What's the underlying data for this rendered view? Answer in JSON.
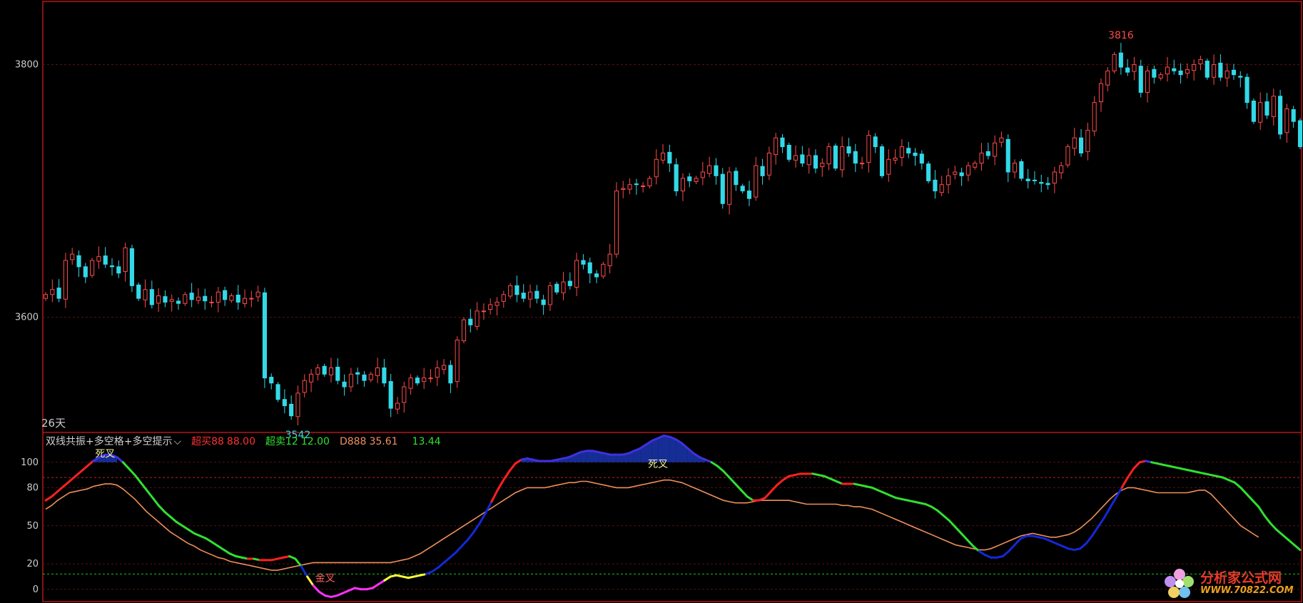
{
  "chart_data": [
    {
      "type": "candlestick",
      "title": "",
      "ylim": [
        3510,
        3850
      ],
      "yticks": [
        3600,
        3800
      ],
      "period_label": "26天",
      "high_label": "3816",
      "low_label": "3542",
      "colors": {
        "up": "#ff4a4a",
        "down": "#33d9e8",
        "frame": "#b01818",
        "grid": "#5a1010"
      },
      "close": [
        3618,
        3622,
        3615,
        3645,
        3650,
        3640,
        3632,
        3645,
        3648,
        3642,
        3640,
        3635,
        3655,
        3625,
        3615,
        3622,
        3610,
        3617,
        3612,
        3614,
        3611,
        3618,
        3614,
        3616,
        3613,
        3612,
        3620,
        3614,
        3617,
        3612,
        3615,
        3615,
        3620,
        3552,
        3548,
        3535,
        3530,
        3522,
        3540,
        3550,
        3555,
        3560,
        3555,
        3560,
        3550,
        3545,
        3555,
        3555,
        3550,
        3555,
        3560,
        3548,
        3528,
        3532,
        3545,
        3552,
        3548,
        3552,
        3552,
        3560,
        3562,
        3548,
        3582,
        3598,
        3594,
        3605,
        3605,
        3610,
        3612,
        3618,
        3625,
        3618,
        3615,
        3620,
        3615,
        3610,
        3625,
        3620,
        3628,
        3625,
        3645,
        3642,
        3635,
        3632,
        3642,
        3650,
        3700,
        3702,
        3705,
        3705,
        3704,
        3710,
        3725,
        3730,
        3722,
        3700,
        3710,
        3708,
        3710,
        3715,
        3720,
        3712,
        3690,
        3715,
        3705,
        3700,
        3694,
        3720,
        3712,
        3730,
        3742,
        3735,
        3725,
        3728,
        3722,
        3728,
        3718,
        3722,
        3735,
        3718,
        3735,
        3730,
        3722,
        3722,
        3744,
        3735,
        3712,
        3725,
        3726,
        3735,
        3730,
        3728,
        3722,
        3708,
        3700,
        3705,
        3712,
        3715,
        3712,
        3720,
        3722,
        3730,
        3728,
        3738,
        3742,
        3715,
        3722,
        3710,
        3708,
        3708,
        3706,
        3705,
        3715,
        3720,
        3735,
        3742,
        3730,
        3748,
        3770,
        3785,
        3795,
        3808,
        3798,
        3794,
        3800,
        3778,
        3795,
        3790,
        3792,
        3798,
        3795,
        3792,
        3796,
        3800,
        3804,
        3790,
        3800,
        3790,
        3795,
        3792,
        3790,
        3770,
        3755,
        3770,
        3760,
        3775,
        3745,
        3765,
        3755,
        3735
      ]
    },
    {
      "type": "line",
      "title": "双线共振+多空格+多空提示",
      "ylim": [
        -8,
        110
      ],
      "yticks": [
        0,
        20,
        50,
        80,
        100
      ],
      "hlines": [
        88,
        12,
        35.61
      ],
      "legend": [
        {
          "label": "超买88",
          "value": "88.00",
          "color": "#ff3030"
        },
        {
          "label": "超卖12",
          "value": "12.00",
          "color": "#30e030"
        },
        {
          "label": "D888",
          "value": "35.61",
          "color": "#f09060"
        },
        {
          "label": "",
          "value": "13.44",
          "color": "#30e030"
        }
      ],
      "annotations": [
        "死叉",
        "死叉",
        "金叉"
      ],
      "series": [
        {
          "values": [
            70,
            73,
            77,
            81,
            85,
            89,
            93,
            97,
            101,
            104,
            106,
            106,
            104,
            100,
            95,
            90,
            84,
            78,
            72,
            66,
            61,
            57,
            53,
            50,
            47,
            44,
            42,
            40,
            37,
            34,
            31,
            28,
            26,
            25,
            24,
            24,
            23,
            23,
            23,
            24,
            25,
            26,
            24,
            18,
            10,
            3,
            -2,
            -5,
            -6,
            -5,
            -3,
            -1,
            1,
            0,
            0,
            1,
            4,
            7,
            10,
            11,
            10,
            9,
            10,
            11,
            12,
            14,
            17,
            21,
            25,
            29,
            34,
            39,
            45,
            52,
            60,
            69,
            78,
            86,
            93,
            99,
            102,
            103,
            102,
            101,
            101,
            101,
            102,
            103,
            104,
            106,
            108,
            109,
            109,
            108,
            107,
            106,
            106,
            106,
            107,
            109,
            111,
            114,
            117,
            119,
            121,
            120,
            118,
            115,
            111,
            107,
            104,
            102,
            100,
            97,
            93,
            88,
            83,
            78,
            73,
            70,
            70,
            72,
            77,
            82,
            86,
            89,
            90,
            91,
            91,
            91,
            90,
            89,
            87,
            85,
            83,
            83,
            83,
            82,
            81,
            80,
            78,
            76,
            74,
            72,
            71,
            70,
            69,
            68,
            67,
            65,
            62,
            58,
            54,
            49,
            44,
            39,
            34,
            30,
            27,
            25,
            25,
            26,
            30,
            35,
            40,
            42,
            42,
            41,
            40,
            38,
            36,
            34,
            32,
            31,
            32,
            36,
            42,
            49,
            56,
            64,
            72,
            80,
            88,
            95,
            100,
            101,
            100,
            99,
            98,
            97,
            96,
            95,
            94,
            93,
            92,
            91,
            90,
            89,
            88,
            86,
            84,
            80,
            75,
            70,
            65,
            58,
            52,
            47,
            43,
            39,
            35,
            31
          ]
        },
        {
          "values": [
            63,
            66,
            70,
            73,
            76,
            77,
            78,
            79,
            81,
            82,
            83,
            83,
            82,
            79,
            75,
            71,
            66,
            61,
            57,
            53,
            49,
            45,
            42,
            39,
            36,
            34,
            31,
            29,
            27,
            25,
            24,
            22,
            21,
            20,
            19,
            18,
            17,
            16,
            15,
            15,
            16,
            17,
            18,
            19,
            20,
            21,
            21,
            21,
            21,
            21,
            21,
            21,
            21,
            21,
            21,
            21,
            21,
            21,
            21,
            22,
            23,
            24,
            26,
            28,
            31,
            34,
            37,
            40,
            43,
            46,
            49,
            52,
            55,
            58,
            61,
            64,
            67,
            70,
            73,
            76,
            78,
            80,
            80,
            80,
            80,
            81,
            82,
            83,
            84,
            84,
            85,
            85,
            84,
            83,
            82,
            81,
            80,
            80,
            80,
            81,
            82,
            83,
            84,
            85,
            86,
            86,
            85,
            84,
            82,
            80,
            78,
            76,
            74,
            72,
            70,
            69,
            68,
            68,
            68,
            69,
            70,
            70,
            70,
            70,
            70,
            70,
            69,
            68,
            67,
            67,
            67,
            67,
            67,
            67,
            66,
            66,
            65,
            65,
            64,
            63,
            61,
            59,
            57,
            55,
            53,
            51,
            49,
            47,
            45,
            43,
            41,
            39,
            37,
            35,
            34,
            33,
            32,
            31,
            31,
            32,
            34,
            36,
            38,
            40,
            42,
            43,
            44,
            43,
            42,
            41,
            41,
            42,
            43,
            45,
            48,
            52,
            56,
            61,
            66,
            71,
            75,
            78,
            80,
            80,
            79,
            78,
            77,
            76,
            76,
            76,
            76,
            76,
            76,
            77,
            78,
            78,
            75,
            70,
            65,
            60,
            55,
            50,
            47,
            44,
            41
          ]
        }
      ]
    }
  ],
  "watermark": {
    "text1": "分析家公式网",
    "text2": "WWW.70822.COM"
  }
}
